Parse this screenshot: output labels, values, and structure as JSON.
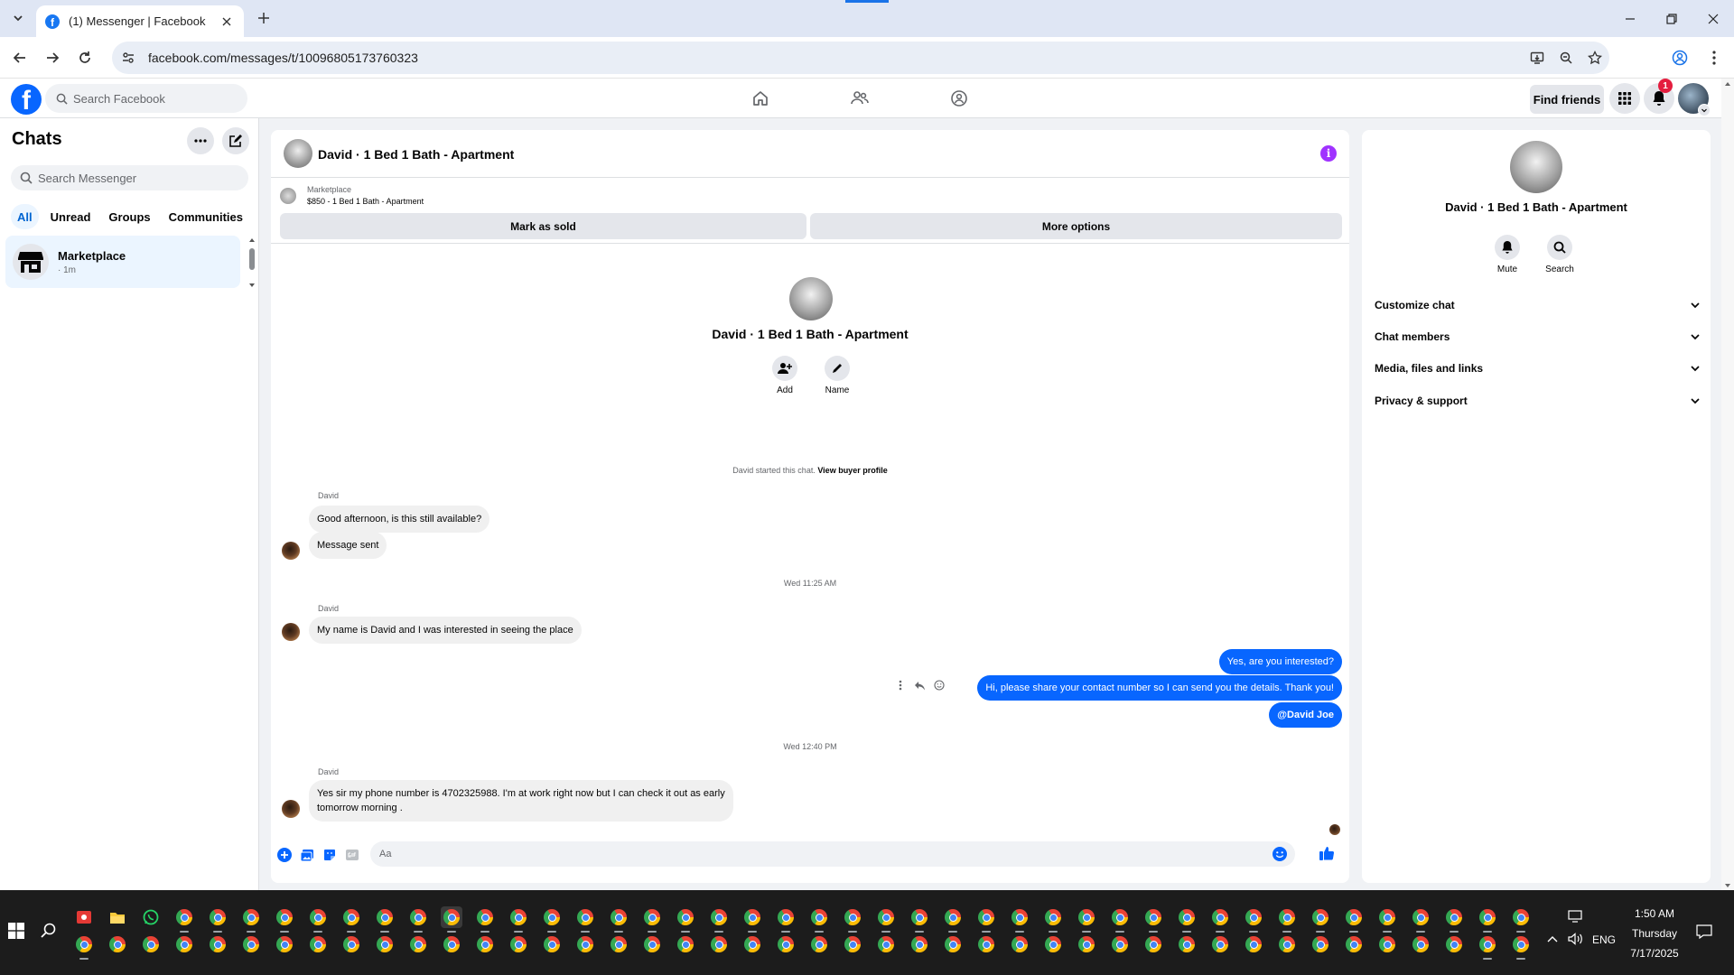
{
  "browser": {
    "tab_title": "(1) Messenger | Facebook",
    "url": "facebook.com/messages/t/10096805173760323"
  },
  "fb_nav": {
    "search_placeholder": "Search Facebook",
    "find_friends": "Find friends",
    "notification_count": "1"
  },
  "chats_panel": {
    "title": "Chats",
    "search_placeholder": "Search Messenger",
    "filters": [
      "All",
      "Unread",
      "Groups",
      "Communities"
    ],
    "active_filter": "All",
    "items": [
      {
        "name": "Marketplace",
        "time": "· 1m"
      }
    ]
  },
  "conversation": {
    "title": "David · 1 Bed 1 Bath - Apartment",
    "listing": {
      "source": "Marketplace",
      "summary": "$850 - 1 Bed 1 Bath - Apartment",
      "mark_sold": "Mark as sold",
      "more_options": "More options"
    },
    "intro": {
      "name": "David · 1 Bed 1 Bath - Apartment",
      "add_label": "Add",
      "name_label": "Name"
    },
    "system_note": "David started this chat.",
    "system_link": "View buyer profile",
    "messages": [
      {
        "sender": "David",
        "text": "Good afternoon, is this still available?"
      },
      {
        "text": "Message sent"
      },
      {
        "separator": "Wed 11:25 AM"
      },
      {
        "sender": "David",
        "text": "My name is David and I was interested in seeing the place"
      },
      {
        "outgoing": "Yes, are you interested?"
      },
      {
        "outgoing": "Hi, please share your contact number so I can send you the details. Thank you!"
      },
      {
        "outgoing": "@David Joe"
      },
      {
        "separator": "Wed 12:40 PM"
      },
      {
        "sender": "David",
        "text": "Yes sir my phone number is 4702325988. I'm at work right now but I can check it out as early tomorrow morning ."
      }
    ],
    "composer_placeholder": "Aa"
  },
  "details_panel": {
    "name": "David · 1 Bed 1 Bath - Apartment",
    "mute_label": "Mute",
    "search_label": "Search",
    "sections": [
      "Customize chat",
      "Chat members",
      "Media, files and links",
      "Privacy & support"
    ]
  },
  "taskbar": {
    "time": "1:50 AM",
    "day": "Thursday",
    "date": "7/17/2025",
    "language": "ENG"
  },
  "colors": {
    "facebook_blue": "#0866ff",
    "outgoing_bubble": "#0866ff",
    "incoming_bubble": "#f0f0f0",
    "info_purple": "#a033ff",
    "notification_red": "#e41e3f"
  }
}
